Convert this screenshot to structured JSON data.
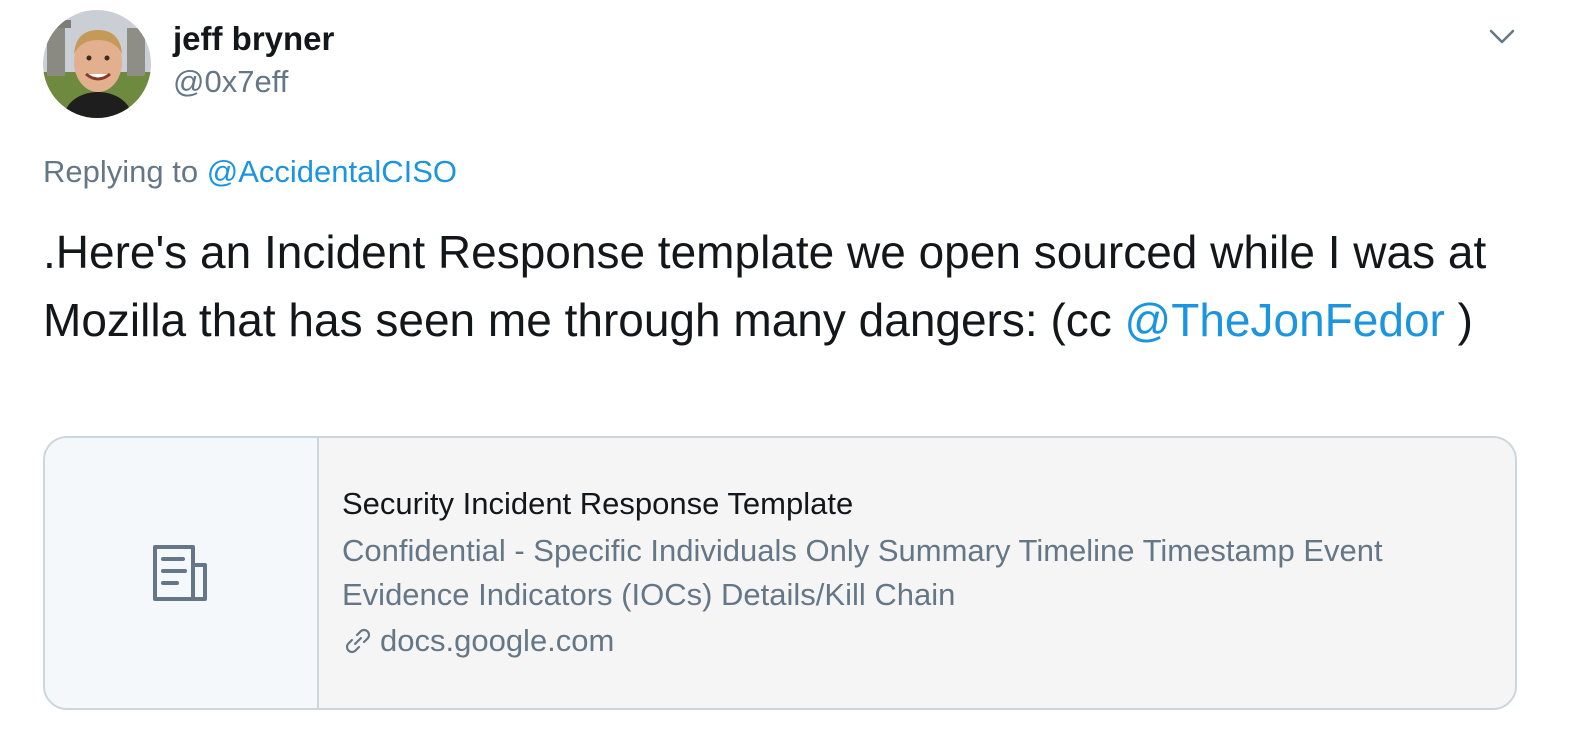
{
  "author": {
    "name": "jeff bryner",
    "handle": "@0x7eff"
  },
  "reply": {
    "prefix": "Replying to ",
    "mention": "@AccidentalCISO"
  },
  "tweet": {
    "text_main": ".Here's an Incident Response template we open sourced while I was at Mozilla that has seen me through many dangers:  (cc ",
    "mention": "@TheJonFedor",
    "text_end": " )"
  },
  "card": {
    "icon": "document-icon",
    "title": "Security Incident Response Template",
    "description": "Confidential - Specific Individuals Only Summary Timeline Timestamp Event Evidence Indicators (IOCs) Details/Kill Chain",
    "domain": "docs.google.com"
  },
  "colors": {
    "link": "#1b95e0",
    "secondary_text": "#657786",
    "primary_text": "#14171a",
    "border": "#ccd6dd"
  }
}
